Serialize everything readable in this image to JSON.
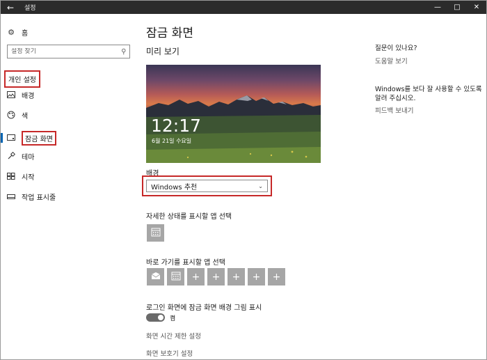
{
  "window": {
    "title": "설정",
    "back_icon": "back-arrow-icon"
  },
  "nav": {
    "home": "홈",
    "search_placeholder": "설정 찾기",
    "section": "개인 설정",
    "items": [
      {
        "label": "배경",
        "icon": "picture-icon"
      },
      {
        "label": "색",
        "icon": "palette-icon"
      },
      {
        "label": "잠금 화면",
        "icon": "lock-screen-icon",
        "active": true
      },
      {
        "label": "테마",
        "icon": "brush-icon"
      },
      {
        "label": "시작",
        "icon": "start-icon"
      },
      {
        "label": "작업 표시줄",
        "icon": "taskbar-icon"
      }
    ]
  },
  "main": {
    "title": "잠금 화면",
    "preview_heading": "미리 보기",
    "preview": {
      "time": "12:17",
      "date": "6월 21일 수요일"
    },
    "background_label": "배경",
    "background_value": "Windows 추천",
    "detailed_status_label": "자세한 상태를 표시할 앱 선택",
    "quick_status_label": "바로 가기를 표시할 앱 선택",
    "signin_bg_label": "로그인 화면에 잠금 화면 배경 그림 표시",
    "toggle_state": "켬",
    "timeout_link": "화면 시간 제한 설정",
    "screensaver_link": "화면 보호기 설정"
  },
  "right": {
    "question_heading": "질문이 있나요?",
    "help_link": "도움말 보기",
    "feedback_heading": "Windows를 보다 잘 사용할 수 있도록 알려 주십시오.",
    "feedback_link": "피드백 보내기"
  },
  "colors": {
    "accent": "#0063b1",
    "highlight": "#c62828",
    "tile": "#a6a6a6"
  }
}
